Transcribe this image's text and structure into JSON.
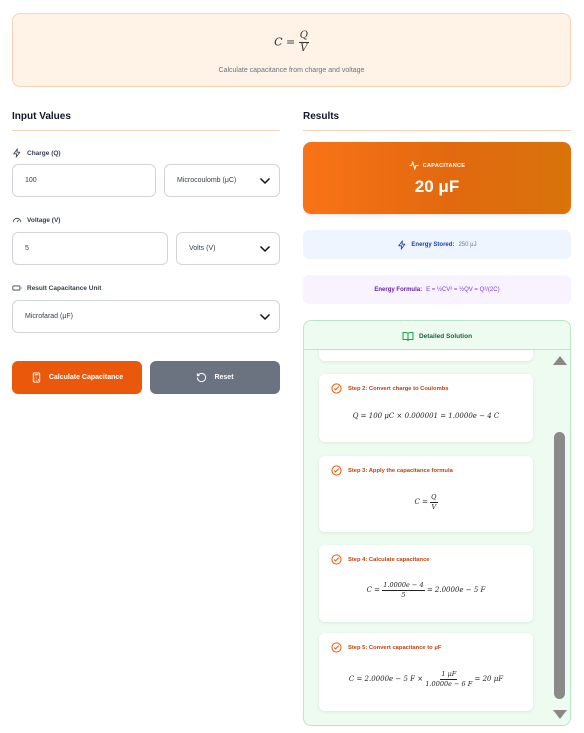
{
  "formula": {
    "lhs": "C",
    "eq": "=",
    "num": "Q",
    "den": "V",
    "caption": "Calculate capacitance from charge and voltage"
  },
  "inputs": {
    "title": "Input Values",
    "charge": {
      "label": "Charge (Q)",
      "value": "100",
      "unit": "Microcoulomb (μC)"
    },
    "voltage": {
      "label": "Voltage (V)",
      "value": "5",
      "unit": "Volts (V)"
    },
    "result_unit": {
      "label": "Result Capacitance Unit",
      "value": "Microfarad (μF)"
    }
  },
  "buttons": {
    "calculate": "Calculate Capacitance",
    "reset": "Reset"
  },
  "results": {
    "title": "Results",
    "capacitance_label": "CAPACITANCE",
    "capacitance_value": "20 μF",
    "energy_label": "Energy Stored:",
    "energy_value": "250 μJ",
    "energy_formula_label": "Energy Formula:",
    "energy_formula_value": "E = ½CV² = ½QV = Q²/(2C)"
  },
  "solution": {
    "title": "Detailed Solution",
    "steps": [
      {
        "title": "Step 2: Convert charge to Coulombs"
      },
      {
        "title": "Step 3: Apply the capacitance formula"
      },
      {
        "title": "Step 4: Calculate capacitance"
      },
      {
        "title": "Step 5: Convert capacitance to μF"
      }
    ],
    "math": {
      "s2": "Q = 100 μC × 0.000001 = 1.0000e − 4 C",
      "s3_lhs": "C =",
      "s3_num": "Q",
      "s3_den": "V",
      "s4_lhs": "C =",
      "s4_num": "1.0000e − 4",
      "s4_den": "5",
      "s4_rhs": "= 2.0000e − 5 F",
      "s5_lhs": "C = 2.0000e − 5 F ×",
      "s5_num": "1 μF",
      "s5_den": "1.0000e − 6 F",
      "s5_rhs": "= 20 μF"
    }
  },
  "colors": {
    "accent": "#ea580c",
    "green": "#16a34a",
    "gray_button": "#6b7280"
  }
}
